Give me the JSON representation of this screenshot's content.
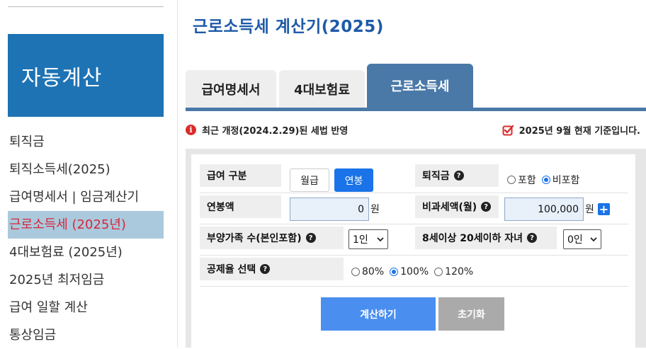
{
  "sidebar": {
    "brand": "자동계산",
    "items": [
      {
        "label": "퇴직금"
      },
      {
        "label": "퇴직소득세(2025)"
      },
      {
        "label": "급여명세서 | 임금계산기"
      },
      {
        "label": "근로소득세 (2025년)"
      },
      {
        "label": "4대보험료 (2025년)"
      },
      {
        "label": "2025년 최저임금"
      },
      {
        "label": "급여 일할 계산"
      },
      {
        "label": "통상임금"
      }
    ]
  },
  "page": {
    "title": "근로소득세 계산기(2025)"
  },
  "tabs": [
    {
      "label": "급여명세서"
    },
    {
      "label": "4대보험료"
    },
    {
      "label": "근로소득세"
    }
  ],
  "notice": {
    "left": "최근 개정(2024.2.29)된 세법 반영",
    "right": "2025년 9월 현재 기준입니다."
  },
  "form": {
    "pay_type": {
      "label": "급여 구분",
      "options": [
        "월급",
        "연봉"
      ],
      "selected": "연봉"
    },
    "severance": {
      "label": "퇴직금",
      "options": [
        "포함",
        "비포함"
      ],
      "selected": "비포함"
    },
    "annual_salary": {
      "label": "연봉액",
      "value": "0",
      "unit": "원"
    },
    "nontaxable": {
      "label": "비과세액(월)",
      "value": "100,000",
      "unit": "원"
    },
    "dependents": {
      "label": "부양가족 수(본인포함)",
      "value": "1인"
    },
    "children": {
      "label": "8세이상 20세이하 자녀",
      "value": "0인"
    },
    "deduction_rate": {
      "label": "공제율 선택",
      "options": [
        "80%",
        "100%",
        "120%"
      ],
      "selected": "100%"
    }
  },
  "actions": {
    "calculate": "계산하기",
    "reset": "초기화"
  },
  "colors": {
    "brand": "#1e73b4",
    "tab_active": "#4a79a8",
    "primary": "#1a73e8",
    "alert": "#d92c2c",
    "active_menu_bg": "#aac9dc",
    "active_menu_text": "#d7263d"
  }
}
